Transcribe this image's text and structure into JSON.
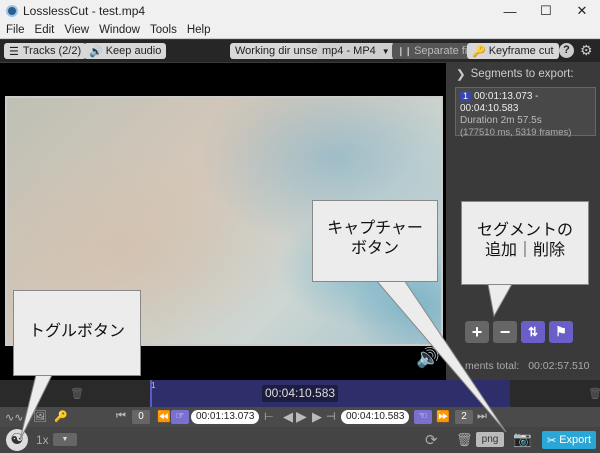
{
  "window": {
    "title": "LosslessCut - test.mp4"
  },
  "menu": [
    "File",
    "Edit",
    "View",
    "Window",
    "Tools",
    "Help"
  ],
  "toolbar": {
    "tracks": "Tracks (2/2)",
    "keep_audio": "Keep audio",
    "working_dir": "Working dir unset",
    "format": "mp4 - MP4",
    "separate_files": "Separate files",
    "keyframe_cut": "Keyframe cut",
    "help": "?"
  },
  "segments": {
    "header": "Segments to export:",
    "item": {
      "index": "1",
      "range": "00:01:13.073 - 00:04:10.583",
      "duration": "Duration 2m 57.5s",
      "detail": "(177510 ms, 5319 frames)"
    },
    "total_label": "ments total:",
    "total_value": "00:02:57.510"
  },
  "timeline": {
    "current_time": "00:04:10.583",
    "segment_marker": "1"
  },
  "controls": {
    "left_marker": "0",
    "start_time": "00:01:13.073",
    "end_time": "00:04:10.583",
    "right_marker": "2",
    "speed": "1x",
    "snapshot_format": "png",
    "export": "Export"
  },
  "callouts": {
    "toggle": "トグルボタン",
    "capture_line1": "キャプチャー",
    "capture_line2": "ボタン",
    "segment_line1": "セグメントの",
    "segment_line2": "追加｜削除"
  }
}
